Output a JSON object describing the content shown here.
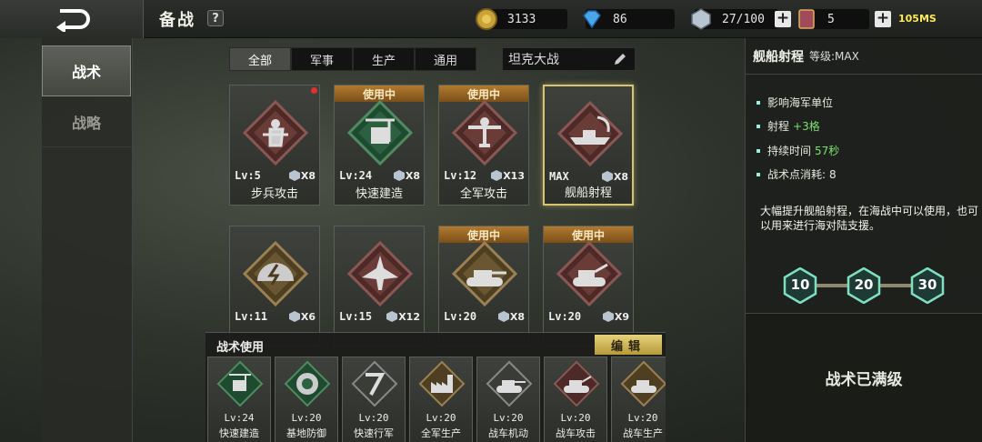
{
  "header": {
    "title": "备战",
    "help": "?",
    "resources": [
      {
        "icon": "gold-coin-icon",
        "value": "3133"
      },
      {
        "icon": "diamond-icon",
        "value": "86"
      },
      {
        "icon": "silver-medal-icon",
        "value": "27/100"
      },
      {
        "icon": "card-icon",
        "value": "5"
      }
    ],
    "plus": "+",
    "signal": "105MS"
  },
  "leftnav": {
    "items": [
      {
        "label": "战术",
        "active": true
      },
      {
        "label": "战略",
        "active": false
      }
    ]
  },
  "tabs": [
    {
      "label": "全部",
      "active": true
    },
    {
      "label": "军事"
    },
    {
      "label": "生产"
    },
    {
      "label": "通用"
    }
  ],
  "filter": {
    "value": "坦克大战"
  },
  "cards": [
    {
      "name": "步兵攻击",
      "level": "Lv:5",
      "cost": "X8",
      "badge": "",
      "dot": true
    },
    {
      "name": "快速建造",
      "level": "Lv:24",
      "cost": "X8",
      "badge": "使用中"
    },
    {
      "name": "全军攻击",
      "level": "Lv:12",
      "cost": "X13",
      "badge": "使用中"
    },
    {
      "name": "舰船射程",
      "level": "MAX",
      "cost": "X8",
      "badge": "",
      "selected": true
    },
    {
      "name": "",
      "level": "Lv:11",
      "cost": "X6",
      "badge": ""
    },
    {
      "name": "",
      "level": "Lv:15",
      "cost": "X12",
      "badge": ""
    },
    {
      "name": "",
      "level": "Lv:20",
      "cost": "X8",
      "badge": "使用中"
    },
    {
      "name": "",
      "level": "Lv:20",
      "cost": "X9",
      "badge": "使用中"
    }
  ],
  "usage": {
    "title": "战术使用",
    "edit_label": "编辑",
    "slots": [
      {
        "level": "Lv:24",
        "name": "快速建造"
      },
      {
        "level": "Lv:20",
        "name": "基地防御"
      },
      {
        "level": "Lv:20",
        "name": "快速行军"
      },
      {
        "level": "Lv:20",
        "name": "全军生产"
      },
      {
        "level": "Lv:20",
        "name": "战车机动"
      },
      {
        "level": "Lv:20",
        "name": "战车攻击"
      },
      {
        "level": "Lv:20",
        "name": "战车生产"
      }
    ]
  },
  "detail": {
    "name": "舰船射程",
    "level": "等级:MAX",
    "attrs": [
      {
        "label": "影响海军单位",
        "value": ""
      },
      {
        "label": "射程",
        "value": "+3格"
      },
      {
        "label": "持续时间",
        "value": "57秒"
      },
      {
        "label": "战术点消耗:",
        "value": "8"
      }
    ],
    "description": "大幅提升舰船射程，在海战中可以使用，也可以用来进行海对陆支援。",
    "milestones": [
      "10",
      "20",
      "30"
    ],
    "status": "战术已满级"
  },
  "colors": {
    "badge": "#b27a2f",
    "edit": "#e6d27a",
    "highlight": "#7de070"
  }
}
